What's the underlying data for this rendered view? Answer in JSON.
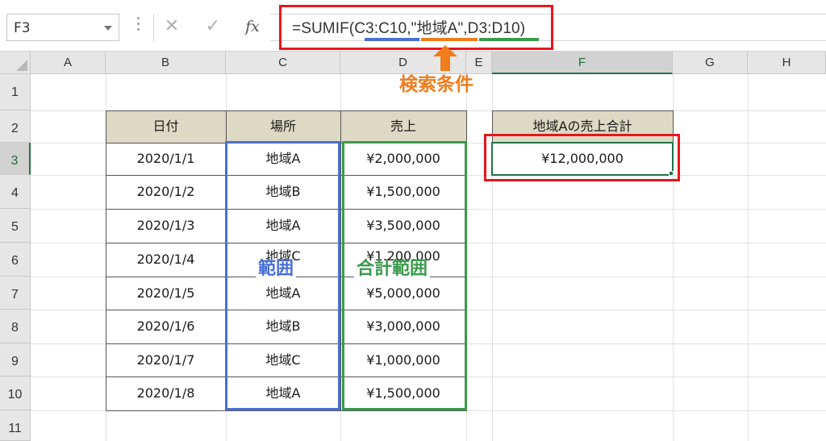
{
  "formula_bar": {
    "name_box": "F3",
    "cancel_icon": "✕",
    "enter_icon": "✓",
    "fx_label": "fx",
    "formula": "=SUMIF(C3:C10,\"地域A\",D3:D10)"
  },
  "columns": [
    "A",
    "B",
    "C",
    "D",
    "E",
    "F",
    "G",
    "H"
  ],
  "rows": [
    "1",
    "2",
    "3",
    "4",
    "5",
    "6",
    "7",
    "8",
    "9",
    "10",
    "11"
  ],
  "table": {
    "headers": [
      "日付",
      "場所",
      "売上"
    ],
    "rows": [
      [
        "2020/1/1",
        "地域A",
        "¥2,000,000"
      ],
      [
        "2020/1/2",
        "地域B",
        "¥1,500,000"
      ],
      [
        "2020/1/3",
        "地域A",
        "¥3,500,000"
      ],
      [
        "2020/1/4",
        "地域C",
        "¥1,200,000"
      ],
      [
        "2020/1/5",
        "地域A",
        "¥5,000,000"
      ],
      [
        "2020/1/6",
        "地域B",
        "¥3,000,000"
      ],
      [
        "2020/1/7",
        "地域C",
        "¥1,000,000"
      ],
      [
        "2020/1/8",
        "地域A",
        "¥1,500,000"
      ]
    ]
  },
  "summary": {
    "header": "地域Aの売上合計",
    "value": "¥12,000,000"
  },
  "annotations": {
    "criteria_label": "検索条件",
    "range_label": "範囲",
    "sum_range_label": "合計範囲"
  },
  "colors": {
    "highlight_red": "#e8161c",
    "range_blue": "#4a6fd6",
    "criteria_orange": "#f07c1c",
    "sum_green": "#3a9a4c",
    "header_fill": "#ddd9c4",
    "excel_green": "#217346"
  }
}
